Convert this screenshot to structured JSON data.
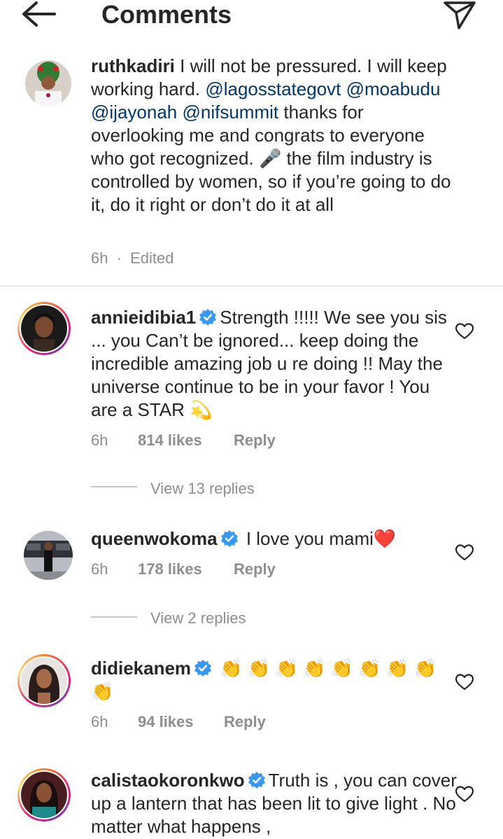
{
  "header": {
    "title": "Comments"
  },
  "caption": {
    "username": "ruthkadiri",
    "text_1": " I will not be pressured. I will keep working hard. ",
    "mentions": [
      "@lagosstategovt",
      "@moabudu",
      "@ijayonah",
      "@nifsummit"
    ],
    "text_2": " thanks for overlooking me and congrats to everyone who got recognized. ",
    "mic_emoji": "🎤",
    "text_3": " the film industry is controlled by women, so if you’re going to do it, do it right or don’t do it at all",
    "time": "6h",
    "edited": "Edited"
  },
  "comments": [
    {
      "username": "annieidibia1",
      "text": "Strength !!!!! We see you sis ... you Can’t be ignored... keep doing the incredible amazing job u re  doing !! May the universe continue to be in your favor ! You are a STAR ",
      "emoji": "💫",
      "time": "6h",
      "likes": "814 likes",
      "reply": "Reply",
      "view_replies": "View 13 replies"
    },
    {
      "username": "queenwokoma",
      "text": "I love you mami",
      "emoji": "❤️",
      "time": "6h",
      "likes": "178 likes",
      "reply": "Reply",
      "view_replies": "View 2 replies"
    },
    {
      "username": "didiekanem",
      "text": "",
      "emoji": "👏 👏 👏 👏 👏 👏 👏 👏 👏",
      "time": "6h",
      "likes": "94 likes",
      "reply": "Reply"
    },
    {
      "username": "calistaokoronkwo",
      "text": "Truth is , you can cover up a lantern that has been lit to give light . No matter what happens ,"
    }
  ],
  "colors": {
    "text": "#262626",
    "secondary": "#8e8e8e",
    "mention": "#00376b",
    "verified": "#3897f0"
  }
}
